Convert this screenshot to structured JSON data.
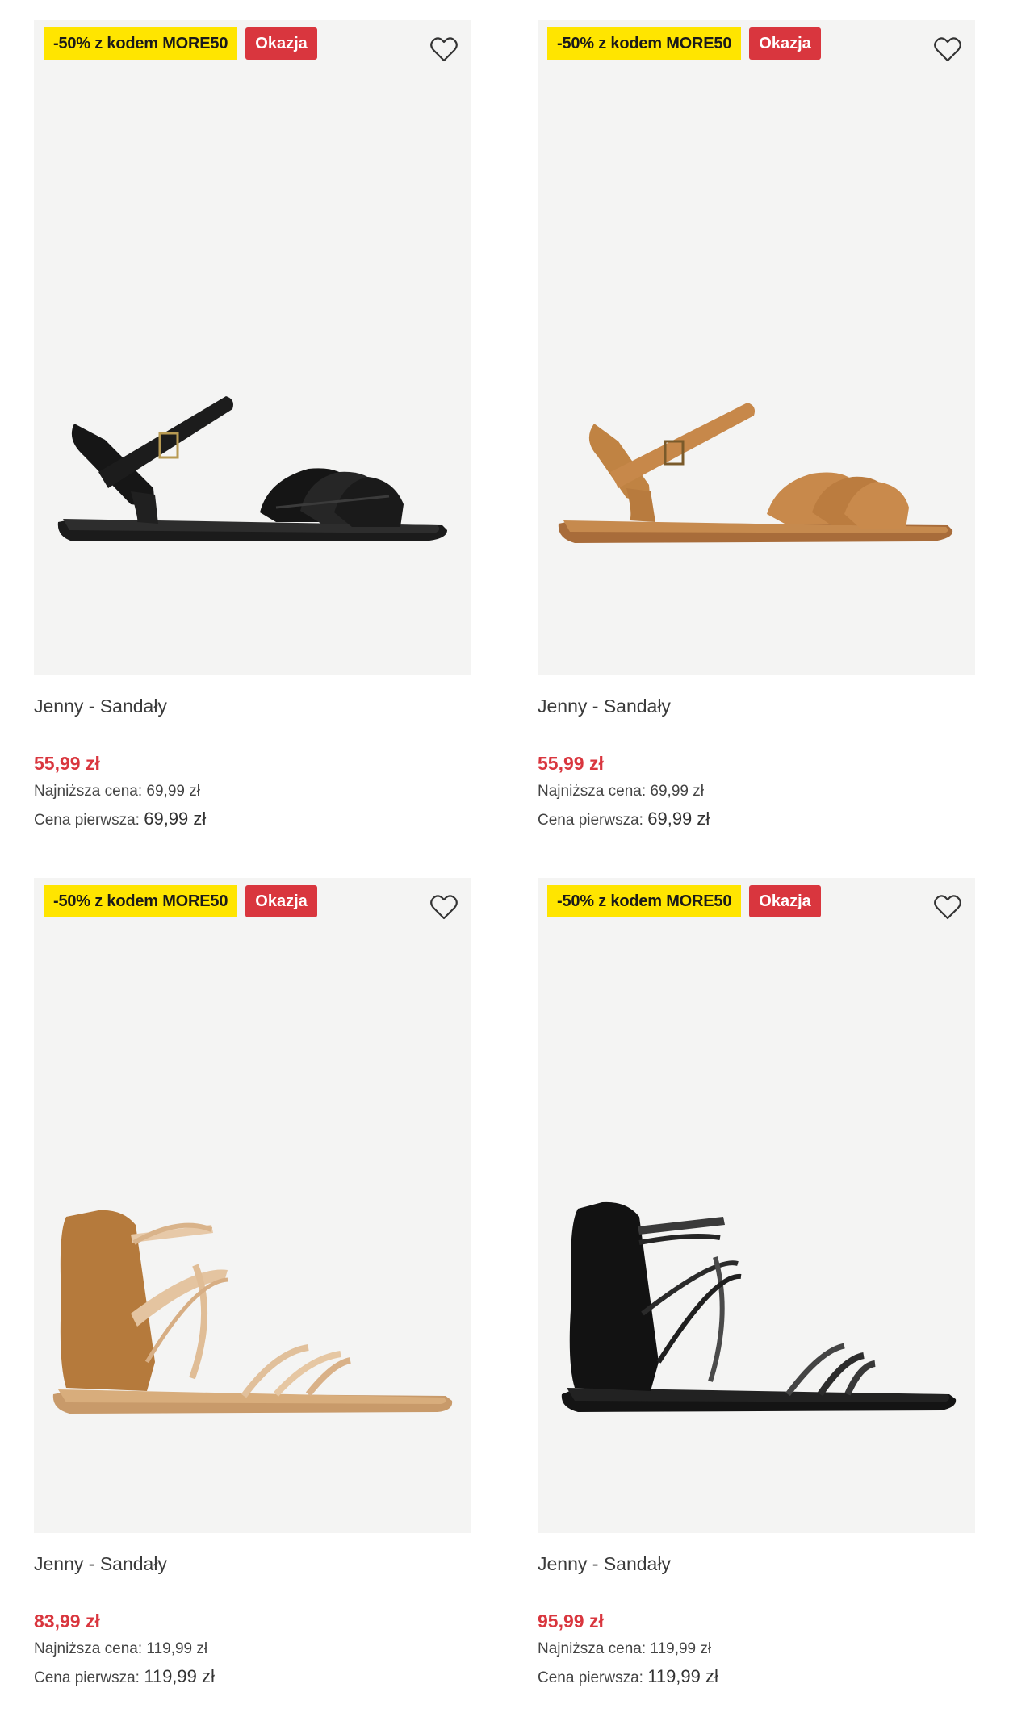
{
  "colors": {
    "promo_badge_bg": "#ffe500",
    "deal_badge_bg": "#d9363e",
    "price": "#d9363e",
    "image_bg": "#f4f4f3"
  },
  "products": [
    {
      "promo_badge": "-50% z kodem MORE50",
      "deal_badge": "Okazja",
      "title": "Jenny - Sandały",
      "price": "55,99 zł",
      "lowest_label": "Najniższa cena:",
      "lowest_value": "69,99 zł",
      "original_label": "Cena pierwsza:",
      "original_value": "69,99 zł",
      "image": "black-strappy-flat-sandal",
      "icon": "heart-outline-icon"
    },
    {
      "promo_badge": "-50% z kodem MORE50",
      "deal_badge": "Okazja",
      "title": "Jenny - Sandały",
      "price": "55,99 zł",
      "lowest_label": "Najniższa cena:",
      "lowest_value": "69,99 zł",
      "original_label": "Cena pierwsza:",
      "original_value": "69,99 zł",
      "image": "tan-strappy-flat-sandal",
      "icon": "heart-outline-icon"
    },
    {
      "promo_badge": "-50% z kodem MORE50",
      "deal_badge": "Okazja",
      "title": "Jenny - Sandały",
      "price": "83,99 zł",
      "lowest_label": "Najniższa cena:",
      "lowest_value": "119,99 zł",
      "original_label": "Cena pierwsza:",
      "original_value": "119,99 zł",
      "image": "tan-heel-cup-rhinestone-sandal",
      "icon": "heart-outline-icon"
    },
    {
      "promo_badge": "-50% z kodem MORE50",
      "deal_badge": "Okazja",
      "title": "Jenny - Sandały",
      "price": "95,99 zł",
      "lowest_label": "Najniższa cena:",
      "lowest_value": "119,99 zł",
      "original_label": "Cena pierwsza:",
      "original_value": "119,99 zł",
      "image": "black-heel-cup-rhinestone-sandal",
      "icon": "heart-outline-icon"
    }
  ]
}
